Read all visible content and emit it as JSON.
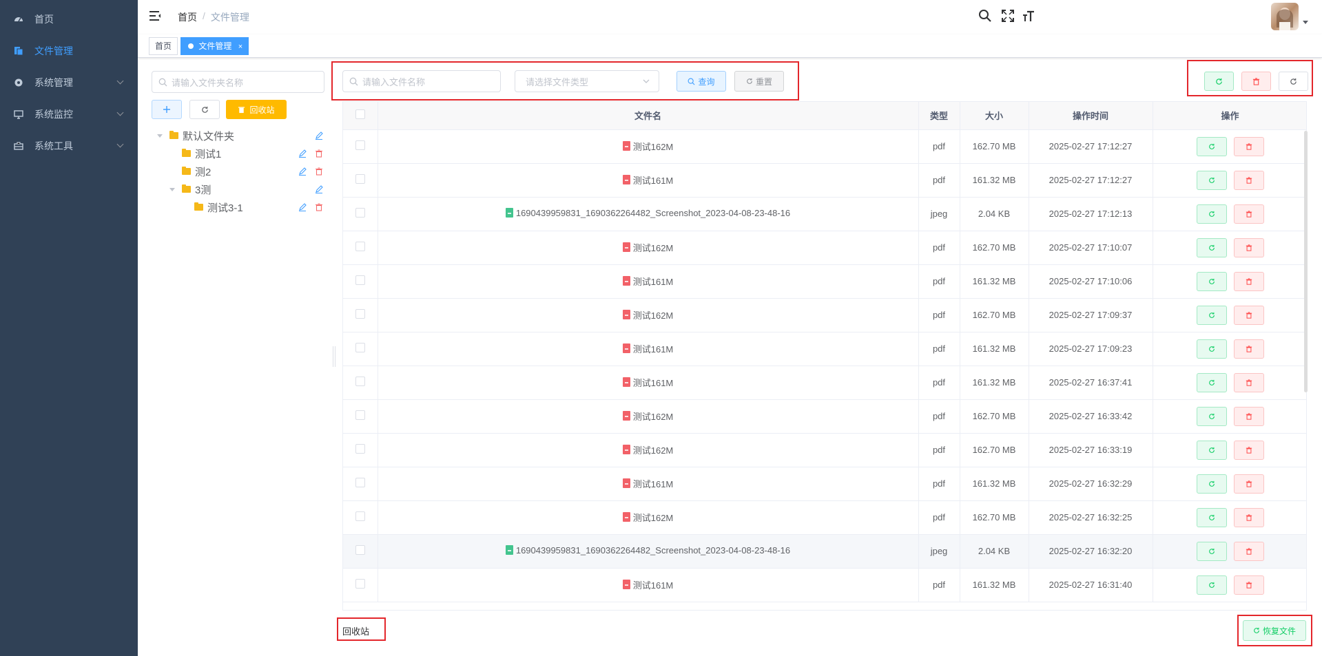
{
  "sidebar": {
    "items": [
      {
        "label": "首页",
        "icon": "dashboard-icon"
      },
      {
        "label": "文件管理",
        "icon": "file-manage-icon",
        "active": true
      },
      {
        "label": "系统管理",
        "icon": "system-gear-icon"
      },
      {
        "label": "系统监控",
        "icon": "monitor-icon"
      },
      {
        "label": "系统工具",
        "icon": "toolbox-icon"
      }
    ]
  },
  "navbar": {
    "breadcrumb": [
      "首页",
      "文件管理"
    ],
    "separator": "/"
  },
  "tags": [
    {
      "label": "首页"
    },
    {
      "label": "文件管理",
      "active": true,
      "close": "×"
    }
  ],
  "folder_panel": {
    "search_placeholder": "请输入文件夹名称",
    "recycle_label": "回收站",
    "tree": [
      {
        "label": "默认文件夹",
        "level": 0,
        "expanded": true
      },
      {
        "label": "测试1",
        "level": 1
      },
      {
        "label": "测2",
        "level": 1
      },
      {
        "label": "3测",
        "level": 1,
        "expanded": true
      },
      {
        "label": "测试3-1",
        "level": 2
      }
    ]
  },
  "filters": {
    "name_placeholder": "请输入文件名称",
    "type_placeholder": "请选择文件类型",
    "query_label": "查询",
    "reset_label": "重置"
  },
  "table": {
    "columns": [
      "文件名",
      "类型",
      "大小",
      "操作时间",
      "操作"
    ],
    "rows": [
      {
        "name": "测试162M",
        "type": "pdf",
        "size": "162.70 MB",
        "time": "2025-02-27 17:12:27"
      },
      {
        "name": "测试161M",
        "type": "pdf",
        "size": "161.32 MB",
        "time": "2025-02-27 17:12:27"
      },
      {
        "name": "1690439959831_1690362264482_Screenshot_2023-04-08-23-48-16",
        "type": "jpeg",
        "size": "2.04 KB",
        "time": "2025-02-27 17:12:13"
      },
      {
        "name": "测试162M",
        "type": "pdf",
        "size": "162.70 MB",
        "time": "2025-02-27 17:10:07"
      },
      {
        "name": "测试161M",
        "type": "pdf",
        "size": "161.32 MB",
        "time": "2025-02-27 17:10:06"
      },
      {
        "name": "测试162M",
        "type": "pdf",
        "size": "162.70 MB",
        "time": "2025-02-27 17:09:37"
      },
      {
        "name": "测试161M",
        "type": "pdf",
        "size": "161.32 MB",
        "time": "2025-02-27 17:09:23"
      },
      {
        "name": "测试161M",
        "type": "pdf",
        "size": "161.32 MB",
        "time": "2025-02-27 16:37:41"
      },
      {
        "name": "测试162M",
        "type": "pdf",
        "size": "162.70 MB",
        "time": "2025-02-27 16:33:42"
      },
      {
        "name": "测试162M",
        "type": "pdf",
        "size": "162.70 MB",
        "time": "2025-02-27 16:33:19"
      },
      {
        "name": "测试161M",
        "type": "pdf",
        "size": "161.32 MB",
        "time": "2025-02-27 16:32:29"
      },
      {
        "name": "测试162M",
        "type": "pdf",
        "size": "162.70 MB",
        "time": "2025-02-27 16:32:25"
      },
      {
        "name": "1690439959831_1690362264482_Screenshot_2023-04-08-23-48-16",
        "type": "jpeg",
        "size": "2.04 KB",
        "time": "2025-02-27 16:32:20"
      },
      {
        "name": "测试161M",
        "type": "pdf",
        "size": "161.32 MB",
        "time": "2025-02-27 16:31:40"
      }
    ]
  },
  "footer": {
    "recycle_label": "回收站",
    "restore_label": "恢复文件"
  },
  "colors": {
    "sidebar_bg": "#304156",
    "accent": "#409eff",
    "warning": "#ffba00",
    "success": "#13ce66",
    "danger": "#ff4949",
    "highlight_box": "#e3262b"
  }
}
